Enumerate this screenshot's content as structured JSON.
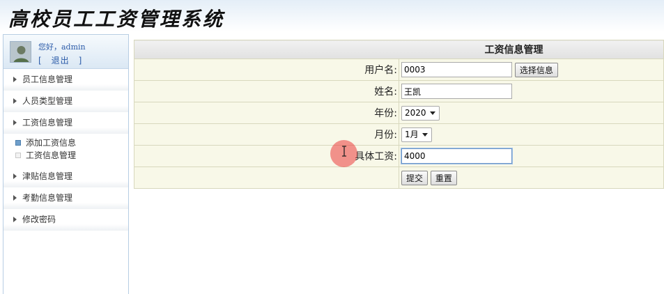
{
  "header": {
    "title": "高校员工工资管理系统"
  },
  "sidebar": {
    "greeting": "您好，admin",
    "logout": "[　退出　]",
    "menu": [
      {
        "label": "员工信息管理"
      },
      {
        "label": "人员类型管理"
      },
      {
        "label": "工资信息管理"
      }
    ],
    "submenu": [
      {
        "label": "添加工资信息",
        "active": true
      },
      {
        "label": "工资信息管理",
        "active": false
      }
    ],
    "menu_after": [
      {
        "label": "津贴信息管理"
      },
      {
        "label": "考勤信息管理"
      },
      {
        "label": "修改密码"
      }
    ]
  },
  "form": {
    "title": "工资信息管理",
    "fields": {
      "username": {
        "label": "用户名:",
        "value": "0003"
      },
      "name": {
        "label": "姓名:",
        "value": "王凯"
      },
      "year": {
        "label": "年份:",
        "value": "2020"
      },
      "month": {
        "label": "月份:",
        "value": "1月"
      },
      "salary": {
        "label": "具体工资:",
        "value": "4000"
      }
    },
    "select_info_button": "选择信息",
    "submit_button": "提交",
    "reset_button": "重置"
  },
  "colors": {
    "accent_link": "#2a5aa8",
    "row_background": "#f8f8e8",
    "cursor_halo": "#eb3c3c"
  }
}
